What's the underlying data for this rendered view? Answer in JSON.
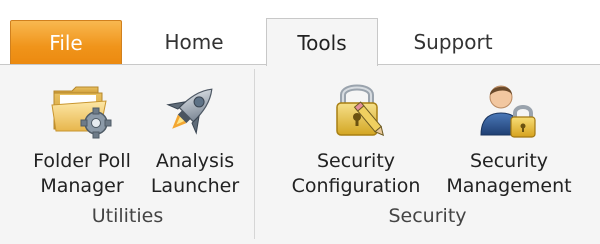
{
  "tabs": {
    "file": "File",
    "home": "Home",
    "tools": "Tools",
    "support": "Support"
  },
  "active_tab": "Tools",
  "groups": {
    "utilities": {
      "label": "Utilities",
      "buttons": {
        "folder_poll_manager": {
          "line1": "Folder Poll",
          "line2": "Manager",
          "icon": "folder-gear-icon"
        },
        "analysis_launcher": {
          "line1": "Analysis",
          "line2": "Launcher",
          "icon": "rocket-icon"
        }
      }
    },
    "security": {
      "label": "Security",
      "buttons": {
        "security_configuration": {
          "line1": "Security",
          "line2": "Configuration",
          "icon": "padlock-pencil-icon"
        },
        "security_management": {
          "line1": "Security",
          "line2": "Management",
          "icon": "user-lock-icon"
        }
      }
    }
  },
  "colors": {
    "file_tab": "#f0941a",
    "ribbon_bg": "#f5f5f5",
    "border": "#c8c8c8"
  }
}
